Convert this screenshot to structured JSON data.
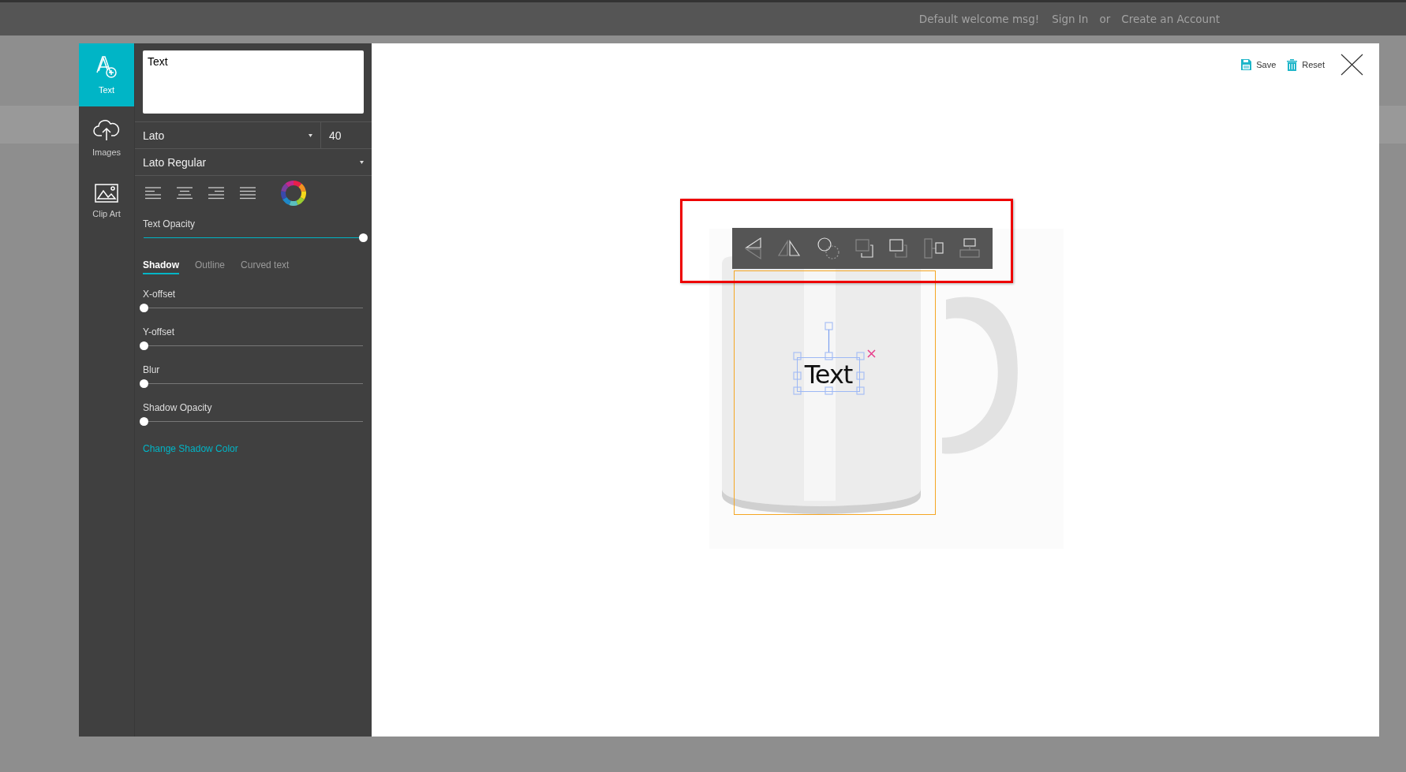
{
  "header": {
    "welcome": "Default welcome msg!",
    "sign_in": "Sign In",
    "separator": "or",
    "create_account": "Create an Account"
  },
  "sidebar": {
    "items": [
      {
        "kind": "text",
        "label": "Text",
        "selected": true
      },
      {
        "kind": "images",
        "label": "Images",
        "selected": false
      },
      {
        "kind": "clipart",
        "label": "Clip Art",
        "selected": false
      }
    ]
  },
  "text_panel": {
    "text_value": "Text",
    "font": "Lato",
    "font_size": "40",
    "font_style": "Lato Regular",
    "text_opacity": {
      "label": "Text Opacity",
      "level": 1
    },
    "tabs": [
      {
        "label": "Shadow",
        "selected": true
      },
      {
        "label": "Outline",
        "selected": false
      },
      {
        "label": "Curved text",
        "selected": false
      }
    ],
    "sliders": [
      {
        "label": "X-offset",
        "level": 0
      },
      {
        "label": "Y-offset",
        "level": 0
      },
      {
        "label": "Blur",
        "level": 0
      },
      {
        "label": "Shadow Opacity",
        "level": 0
      }
    ],
    "link": "Change Shadow Color"
  },
  "canvas": {
    "actions": [
      {
        "kind": "save",
        "label": "Save"
      },
      {
        "kind": "reset",
        "label": "Reset"
      }
    ],
    "design_text": "Text"
  }
}
